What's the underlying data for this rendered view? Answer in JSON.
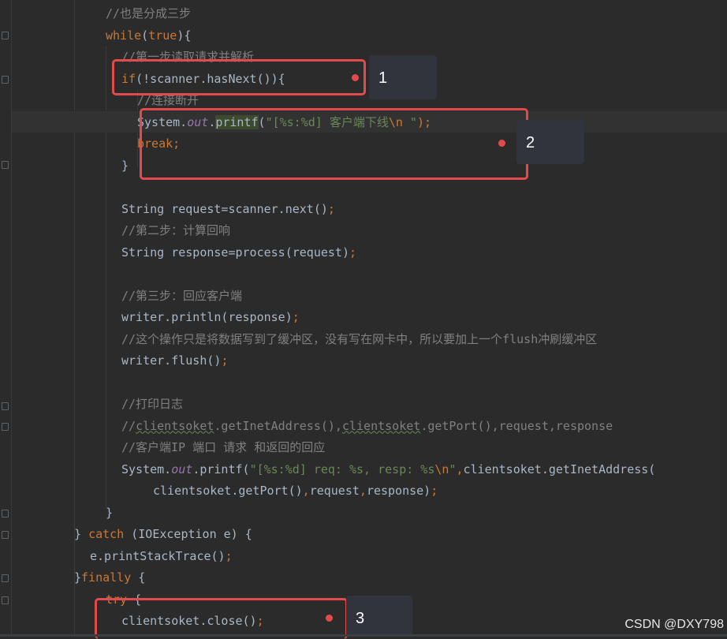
{
  "code_lines": [
    {
      "indent": 4,
      "tokens": [
        {
          "t": "//也是分成三步",
          "c": "com"
        }
      ]
    },
    {
      "indent": 4,
      "tokens": [
        {
          "t": "while",
          "c": "kw"
        },
        {
          "t": "(",
          "c": "default"
        },
        {
          "t": "true",
          "c": "kw"
        },
        {
          "t": "){",
          "c": "default"
        }
      ]
    },
    {
      "indent": 5,
      "tokens": [
        {
          "t": "//第一步读取请求并解析",
          "c": "com"
        }
      ]
    },
    {
      "indent": 5,
      "tokens": [
        {
          "t": "if",
          "c": "kw"
        },
        {
          "t": "(!scanner.hasNext()){",
          "c": "default"
        }
      ]
    },
    {
      "indent": 6,
      "tokens": [
        {
          "t": "//连接断开",
          "c": "com"
        }
      ]
    },
    {
      "indent": 6,
      "tokens": [
        {
          "t": "System.",
          "c": "default"
        },
        {
          "t": "out",
          "c": "field"
        },
        {
          "t": ".",
          "c": "default"
        },
        {
          "t": "printf",
          "c": "hl"
        },
        {
          "t": "(",
          "c": "default"
        },
        {
          "t": "\"[%s:%d] 客户端下线",
          "c": "str"
        },
        {
          "t": "\\n",
          "c": "esc"
        },
        {
          "t": " \"",
          "c": "str"
        },
        {
          "t": ");",
          "c": "semi"
        }
      ]
    },
    {
      "indent": 6,
      "tokens": [
        {
          "t": "break;",
          "c": "kw"
        }
      ]
    },
    {
      "indent": 5,
      "tokens": [
        {
          "t": "}",
          "c": "default"
        }
      ]
    },
    {
      "indent": 0,
      "tokens": []
    },
    {
      "indent": 5,
      "tokens": [
        {
          "t": "String request=scanner.next()",
          "c": "default"
        },
        {
          "t": ";",
          "c": "semi"
        }
      ]
    },
    {
      "indent": 5,
      "tokens": [
        {
          "t": "//第二步：计算回响",
          "c": "com"
        }
      ]
    },
    {
      "indent": 5,
      "tokens": [
        {
          "t": "String response=process(request)",
          "c": "default"
        },
        {
          "t": ";",
          "c": "semi"
        }
      ]
    },
    {
      "indent": 0,
      "tokens": []
    },
    {
      "indent": 5,
      "tokens": [
        {
          "t": "//第三步：回应客户端",
          "c": "com"
        }
      ]
    },
    {
      "indent": 5,
      "tokens": [
        {
          "t": "writer.println(response)",
          "c": "default"
        },
        {
          "t": ";",
          "c": "semi"
        }
      ]
    },
    {
      "indent": 5,
      "tokens": [
        {
          "t": "//这个操作只是将数据写到了缓冲区，没有写在网卡中，所以要加上一个flush冲刷缓冲区",
          "c": "com"
        }
      ]
    },
    {
      "indent": 5,
      "tokens": [
        {
          "t": "writer.flush()",
          "c": "default"
        },
        {
          "t": ";",
          "c": "semi"
        }
      ]
    },
    {
      "indent": 0,
      "tokens": []
    },
    {
      "indent": 5,
      "tokens": [
        {
          "t": "//打印日志",
          "c": "com"
        }
      ]
    },
    {
      "indent": 5,
      "tokens": [
        {
          "t": "//",
          "c": "com"
        },
        {
          "t": "clientsoket",
          "c": "comu"
        },
        {
          "t": ".getInetAddress(),",
          "c": "com"
        },
        {
          "t": "clientsoket",
          "c": "comu"
        },
        {
          "t": ".getPort(),request,response",
          "c": "com"
        }
      ]
    },
    {
      "indent": 5,
      "tokens": [
        {
          "t": "//客户端IP 端口 请求 和返回的回应",
          "c": "com"
        }
      ]
    },
    {
      "indent": 5,
      "tokens": [
        {
          "t": "System.",
          "c": "default"
        },
        {
          "t": "out",
          "c": "field"
        },
        {
          "t": ".printf(",
          "c": "default"
        },
        {
          "t": "\"[%s:%d] req: %s, resp: %s",
          "c": "str"
        },
        {
          "t": "\\n",
          "c": "esc"
        },
        {
          "t": "\"",
          "c": "str"
        },
        {
          "t": ",",
          "c": "semi"
        },
        {
          "t": "clientsoket.getInetAddress(",
          "c": "default"
        }
      ]
    },
    {
      "indent": 7,
      "tokens": [
        {
          "t": "clientsoket.getPort()",
          "c": "default"
        },
        {
          "t": ",",
          "c": "semi"
        },
        {
          "t": "request",
          "c": "default"
        },
        {
          "t": ",",
          "c": "semi"
        },
        {
          "t": "response)",
          "c": "default"
        },
        {
          "t": ";",
          "c": "semi"
        }
      ]
    },
    {
      "indent": 4,
      "tokens": [
        {
          "t": "}",
          "c": "default"
        }
      ]
    },
    {
      "indent": 2,
      "tokens": [
        {
          "t": "} ",
          "c": "default"
        },
        {
          "t": "catch",
          "c": "kw"
        },
        {
          "t": " (IOException e) {",
          "c": "default"
        }
      ]
    },
    {
      "indent": 3,
      "tokens": [
        {
          "t": "e.printStackTrace()",
          "c": "default"
        },
        {
          "t": ";",
          "c": "semi"
        }
      ]
    },
    {
      "indent": 2,
      "tokens": [
        {
          "t": "}",
          "c": "default"
        },
        {
          "t": "finally",
          "c": "kw"
        },
        {
          "t": " {",
          "c": "default"
        }
      ]
    },
    {
      "indent": 4,
      "tokens": [
        {
          "t": "try",
          "c": "kw"
        },
        {
          "t": " {",
          "c": "default"
        }
      ]
    },
    {
      "indent": 5,
      "tokens": [
        {
          "t": "clientsoket.close()",
          "c": "default"
        },
        {
          "t": ";",
          "c": "semi"
        }
      ]
    }
  ],
  "annotations": [
    {
      "label": "1"
    },
    {
      "label": "2"
    },
    {
      "label": "3"
    }
  ],
  "watermark": "CSDN @DXY798",
  "colors": {
    "background": "#2b2b2b",
    "keyword": "#cc7832",
    "string": "#6a8759",
    "comment": "#808080",
    "field": "#9876aa",
    "text": "#a9b7c6",
    "annotation": "#e24b4b"
  }
}
